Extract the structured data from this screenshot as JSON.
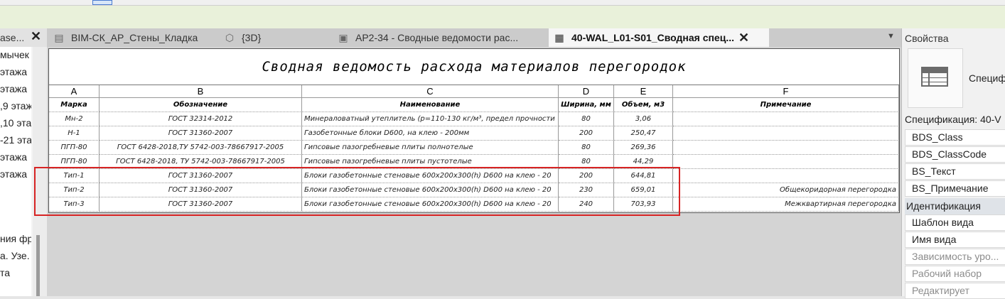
{
  "left_panel": {
    "title": "ase...",
    "items": [
      "мычек",
      "этажа",
      "этажа",
      ",9 этаж",
      ",10 эта",
      "-21 эта",
      "этажа",
      "этажа",
      "ния фр",
      "а. Узе.",
      "та"
    ]
  },
  "tabs": [
    {
      "label": "BIM-СК_АР_Стены_Кладка",
      "icon": "floor-plan-icon"
    },
    {
      "label": "{3D}",
      "icon": "3d-view-icon"
    },
    {
      "label": "AP2-34 - Сводные ведомости рас...",
      "icon": "sheet-icon"
    },
    {
      "label": "40-WAL_L01-S01_Сводная спец...",
      "icon": "schedule-icon",
      "active": true
    }
  ],
  "schedule": {
    "title": "Сводная ведомость расхода материалов перегородок",
    "column_letters": [
      "A",
      "B",
      "C",
      "D",
      "E",
      "F"
    ],
    "headers": [
      "Марка",
      "Обозначение",
      "Наименование",
      "Ширина, мм",
      "Объем, м3",
      "Примечание"
    ],
    "rows": [
      [
        "Мн-2",
        "ГОСТ 32314-2012",
        "Минераловатный утеплитель (p=110-130 кг/м³, предел прочности",
        "80",
        "3,06",
        ""
      ],
      [
        "Н-1",
        "ГОСТ 31360-2007",
        "Газобетонные блоки  D600, на клею - 200мм",
        "200",
        "250,47",
        ""
      ],
      [
        "ПГП-80",
        "ГОСТ 6428-2018,ТУ 5742-003-78667917-2005",
        "Гипсовые пазогребневые плиты полнотелые",
        "80",
        "269,36",
        ""
      ],
      [
        "ПГП-80",
        "ГОСТ 6428-2018, ТУ 5742-003-78667917-2005",
        "Гипсовые пазогребневые плиты пустотелые",
        "80",
        "44,29",
        ""
      ],
      [
        "Тип-1",
        "ГОСТ 31360-2007",
        "Блоки газобетонные стеновые 600х200х300(h) D600 на клею - 20",
        "200",
        "644,81",
        ""
      ],
      [
        "Тип-2",
        "ГОСТ 31360-2007",
        "Блоки газобетонные стеновые 600х200х300(h) D600 на клею - 20",
        "230",
        "659,01",
        "Общекоридорная перегородка"
      ],
      [
        "Тип-3",
        "ГОСТ 31360-2007",
        "Блоки газобетонные стеновые 600х200х300(h) D600 на клею - 20",
        "240",
        "703,93",
        "Межквартирная перегородка"
      ]
    ]
  },
  "properties": {
    "title": "Свойства",
    "type_label": "Специф",
    "selector": "Спецификация: 40-V",
    "params": [
      "BDS_Class",
      "BDS_ClassCode",
      "BS_Текст",
      "BS_Примечание"
    ],
    "group": "Идентификация",
    "params2": [
      "Шаблон вида",
      "Имя вида"
    ],
    "params_grey": [
      "Зависимость уро...",
      "Рабочий набор",
      "Редактирует"
    ]
  },
  "colors": {
    "highlight": "#d72424",
    "ribbon": "#e9f1da"
  }
}
